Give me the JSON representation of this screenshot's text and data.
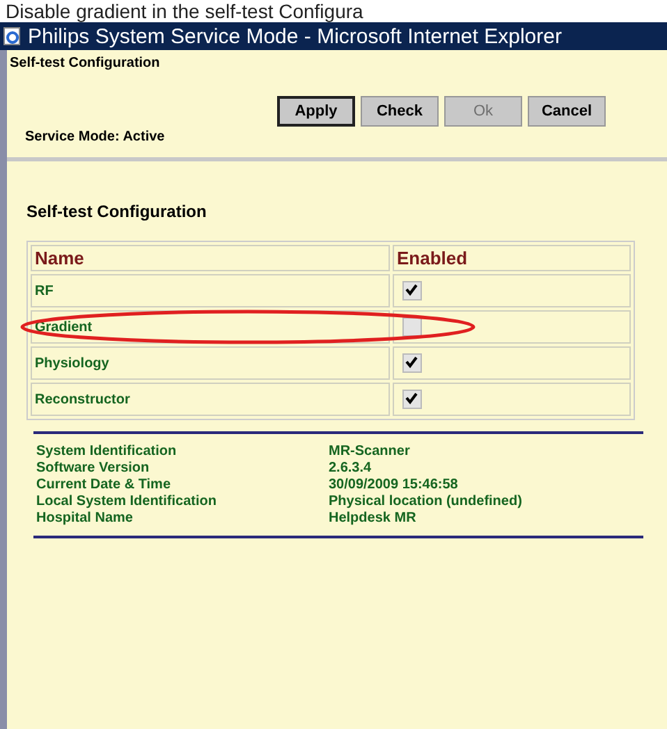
{
  "caption": "Disable gradient in the self-test Configura",
  "window": {
    "title": "Philips System Service Mode - Microsoft Internet Explorer"
  },
  "header": {
    "title": "Self-test Configuration",
    "status": "Service Mode: Active",
    "buttons": [
      {
        "label": "Apply",
        "disabled": false,
        "selected": true
      },
      {
        "label": "Check",
        "disabled": false,
        "selected": false
      },
      {
        "label": "Ok",
        "disabled": true,
        "selected": false
      },
      {
        "label": "Cancel",
        "disabled": false,
        "selected": false
      }
    ]
  },
  "section_title": "Self-test Configuration",
  "table": {
    "columns": [
      "Name",
      "Enabled"
    ],
    "rows": [
      {
        "name": "RF",
        "checked": true,
        "highlighted": false
      },
      {
        "name": "Gradient",
        "checked": false,
        "highlighted": true
      },
      {
        "name": "Physiology",
        "checked": true,
        "highlighted": false
      },
      {
        "name": "Reconstructor",
        "checked": true,
        "highlighted": false
      }
    ]
  },
  "info": [
    {
      "label": "System Identification",
      "value": "MR-Scanner"
    },
    {
      "label": "Software Version",
      "value": "2.6.3.4"
    },
    {
      "label": "Current Date & Time",
      "value": "30/09/2009 15:46:58"
    },
    {
      "label": "Local System Identification",
      "value": "Physical location (undefined)"
    },
    {
      "label": "Hospital Name",
      "value": "Helpdesk MR"
    }
  ]
}
